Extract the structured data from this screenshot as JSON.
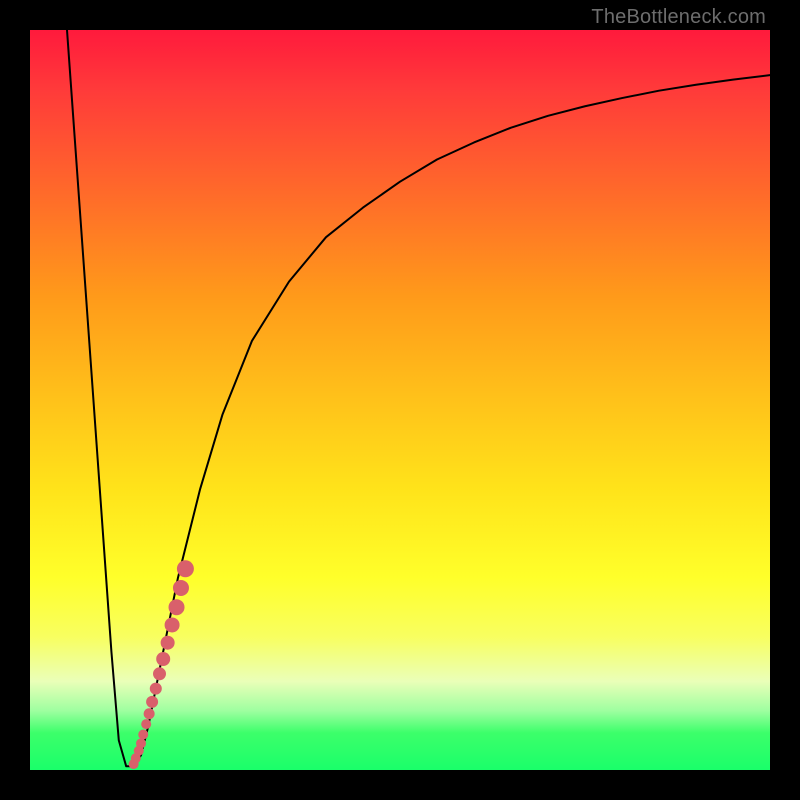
{
  "watermark": "TheBottleneck.com",
  "chart_data": {
    "type": "line",
    "title": "",
    "xlabel": "",
    "ylabel": "",
    "xlim": [
      0,
      100
    ],
    "ylim": [
      0,
      100
    ],
    "series": [
      {
        "name": "curve",
        "x": [
          5,
          6,
          7,
          8,
          9,
          10,
          11,
          12,
          13,
          14,
          15,
          16,
          18,
          20,
          23,
          26,
          30,
          35,
          40,
          45,
          50,
          55,
          60,
          65,
          70,
          75,
          80,
          85,
          90,
          95,
          100
        ],
        "y": [
          100,
          86,
          72,
          58,
          44,
          30,
          16,
          4,
          0.5,
          0.5,
          2,
          6,
          16,
          26,
          38,
          48,
          58,
          66,
          72,
          76,
          79.5,
          82.5,
          84.8,
          86.8,
          88.4,
          89.7,
          90.8,
          91.8,
          92.6,
          93.3,
          93.9
        ],
        "color": "#000000",
        "stroke_width": 2
      }
    ],
    "markers": [
      {
        "name": "dot-trail",
        "color": "#d9606b",
        "points": [
          {
            "x": 14.0,
            "y": 0.8,
            "r": 5
          },
          {
            "x": 14.3,
            "y": 1.6,
            "r": 5
          },
          {
            "x": 14.7,
            "y": 2.6,
            "r": 5
          },
          {
            "x": 15.0,
            "y": 3.6,
            "r": 5
          },
          {
            "x": 15.3,
            "y": 4.8,
            "r": 5
          },
          {
            "x": 15.7,
            "y": 6.2,
            "r": 5
          },
          {
            "x": 16.1,
            "y": 7.6,
            "r": 5.5
          },
          {
            "x": 16.5,
            "y": 9.2,
            "r": 6
          },
          {
            "x": 17.0,
            "y": 11.0,
            "r": 6
          },
          {
            "x": 17.5,
            "y": 13.0,
            "r": 6.5
          },
          {
            "x": 18.0,
            "y": 15.0,
            "r": 7
          },
          {
            "x": 18.6,
            "y": 17.2,
            "r": 7
          },
          {
            "x": 19.2,
            "y": 19.6,
            "r": 7.5
          },
          {
            "x": 19.8,
            "y": 22.0,
            "r": 8
          },
          {
            "x": 20.4,
            "y": 24.6,
            "r": 8
          },
          {
            "x": 21.0,
            "y": 27.2,
            "r": 8.5
          }
        ]
      }
    ],
    "gradient_bands": true,
    "colors": {
      "curve": "#000000",
      "marker": "#d9606b",
      "frame": "#000000"
    }
  }
}
